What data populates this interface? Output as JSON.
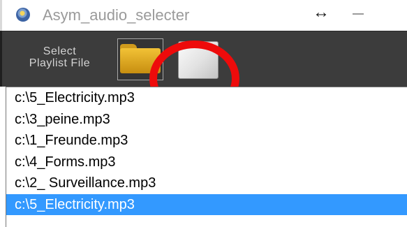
{
  "window": {
    "title": "Asym_audio_selecter",
    "resize_glyph": "↔",
    "icon": "app-disc-icon"
  },
  "toolbar": {
    "select_label": "Select\nPlaylist File",
    "folder_icon": "folder-icon"
  },
  "playlist": {
    "selected_index": 5,
    "items": [
      {
        "label": "c:\\5_Electricity.mp3"
      },
      {
        "label": "c:\\3_peine.mp3"
      },
      {
        "label": "c:\\1_Freunde.mp3"
      },
      {
        "label": "c:\\4_Forms.mp3"
      },
      {
        "label": "c:\\2_ Surveillance.mp3"
      },
      {
        "label": "c:\\5_Electricity.mp3"
      }
    ]
  },
  "colors": {
    "toolbar_bg": "#3c3c3c",
    "selection": "#3399ff",
    "annotation": "#ee0b0b",
    "folder": "#e8b22a"
  }
}
